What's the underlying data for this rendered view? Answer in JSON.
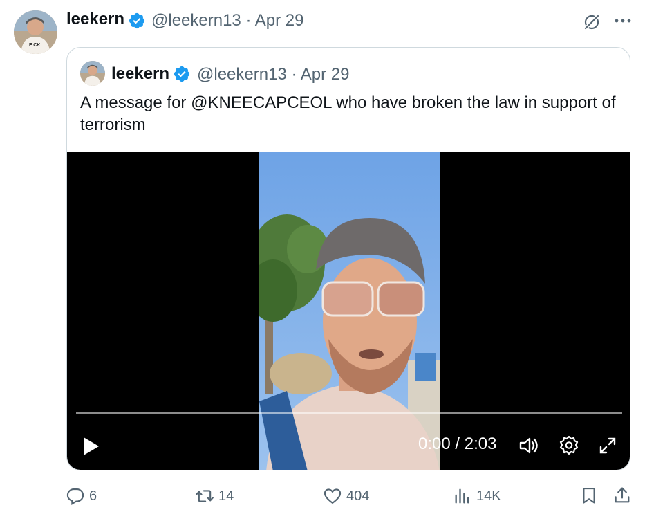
{
  "post": {
    "author_name": "leekern",
    "meta": "@leekern13 · Apr 29"
  },
  "quoted": {
    "author_name": "leekern",
    "meta": "@leekern13 · Apr 29",
    "text": "A message for @KNEECAPCEOL who have broken the law in support of terrorism"
  },
  "video": {
    "time": "0:00 / 2:03",
    "progress": 0
  },
  "actions": {
    "replies": "6",
    "reposts": "14",
    "likes": "404",
    "views": "14K"
  },
  "colors": {
    "verified": "#1d9bf0",
    "muted_text": "#536471",
    "primary_text": "#0f1419",
    "border": "#cfd9de"
  },
  "icons": [
    "verified-badge-icon",
    "grok-icon",
    "more-icon",
    "play-icon",
    "volume-icon",
    "settings-icon",
    "fullscreen-icon",
    "reply-icon",
    "repost-icon",
    "like-icon",
    "views-icon",
    "bookmark-icon",
    "share-icon"
  ]
}
